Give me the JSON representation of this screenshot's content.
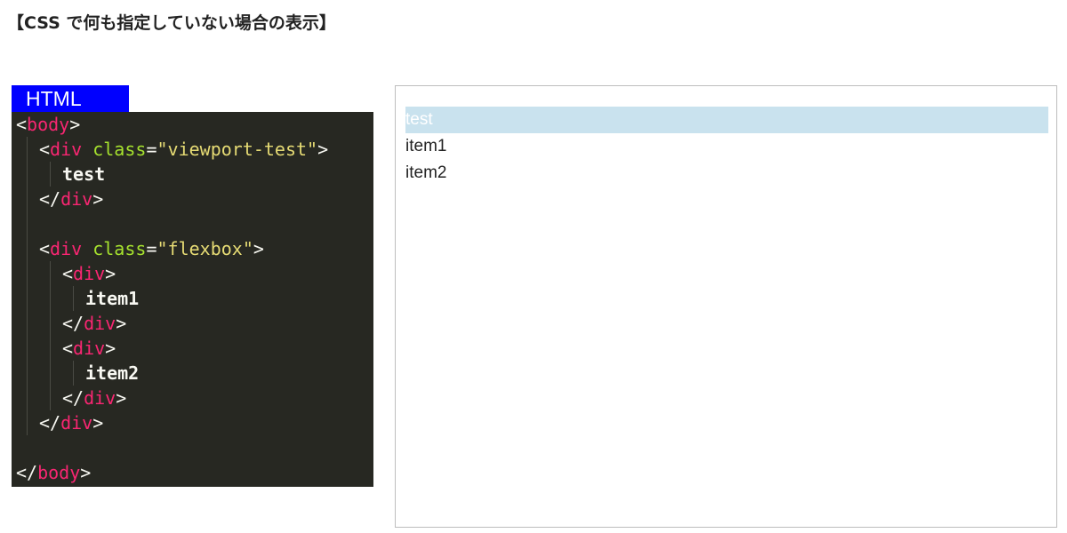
{
  "page": {
    "heading": "【CSS で何も指定していない場合の表示】"
  },
  "code_panel": {
    "tab_label": "HTML",
    "lines": {
      "l1_lt": "<",
      "l1_tag": "body",
      "l1_gt": ">",
      "l2_lt": "<",
      "l2_tag": "div",
      "l2_sp": " ",
      "l2_attr": "class",
      "l2_eq": "=",
      "l2_val": "\"viewport-test\"",
      "l2_gt": ">",
      "l3_text": "test",
      "l4_lt": "</",
      "l4_tag": "div",
      "l4_gt": ">",
      "l6_lt": "<",
      "l6_tag": "div",
      "l6_sp": " ",
      "l6_attr": "class",
      "l6_eq": "=",
      "l6_val": "\"flexbox\"",
      "l6_gt": ">",
      "l7_lt": "<",
      "l7_tag": "div",
      "l7_gt": ">",
      "l8_text": "item1",
      "l9_lt": "</",
      "l9_tag": "div",
      "l9_gt": ">",
      "l10_lt": "<",
      "l10_tag": "div",
      "l10_gt": ">",
      "l11_text": "item2",
      "l12_lt": "</",
      "l12_tag": "div",
      "l12_gt": ">",
      "l13_lt": "</",
      "l13_tag": "div",
      "l13_gt": ">",
      "l15_lt": "</",
      "l15_tag": "body",
      "l15_gt": ">"
    }
  },
  "preview": {
    "viewport_test": "test",
    "item1": "item1",
    "item2": "item2"
  },
  "colors": {
    "tab_background": "#0000ff",
    "code_background": "#272822",
    "tag_name": "#f92672",
    "attribute_name": "#a6e22e",
    "attribute_value": "#e6db74",
    "highlight_box": "#c9e2ee"
  }
}
